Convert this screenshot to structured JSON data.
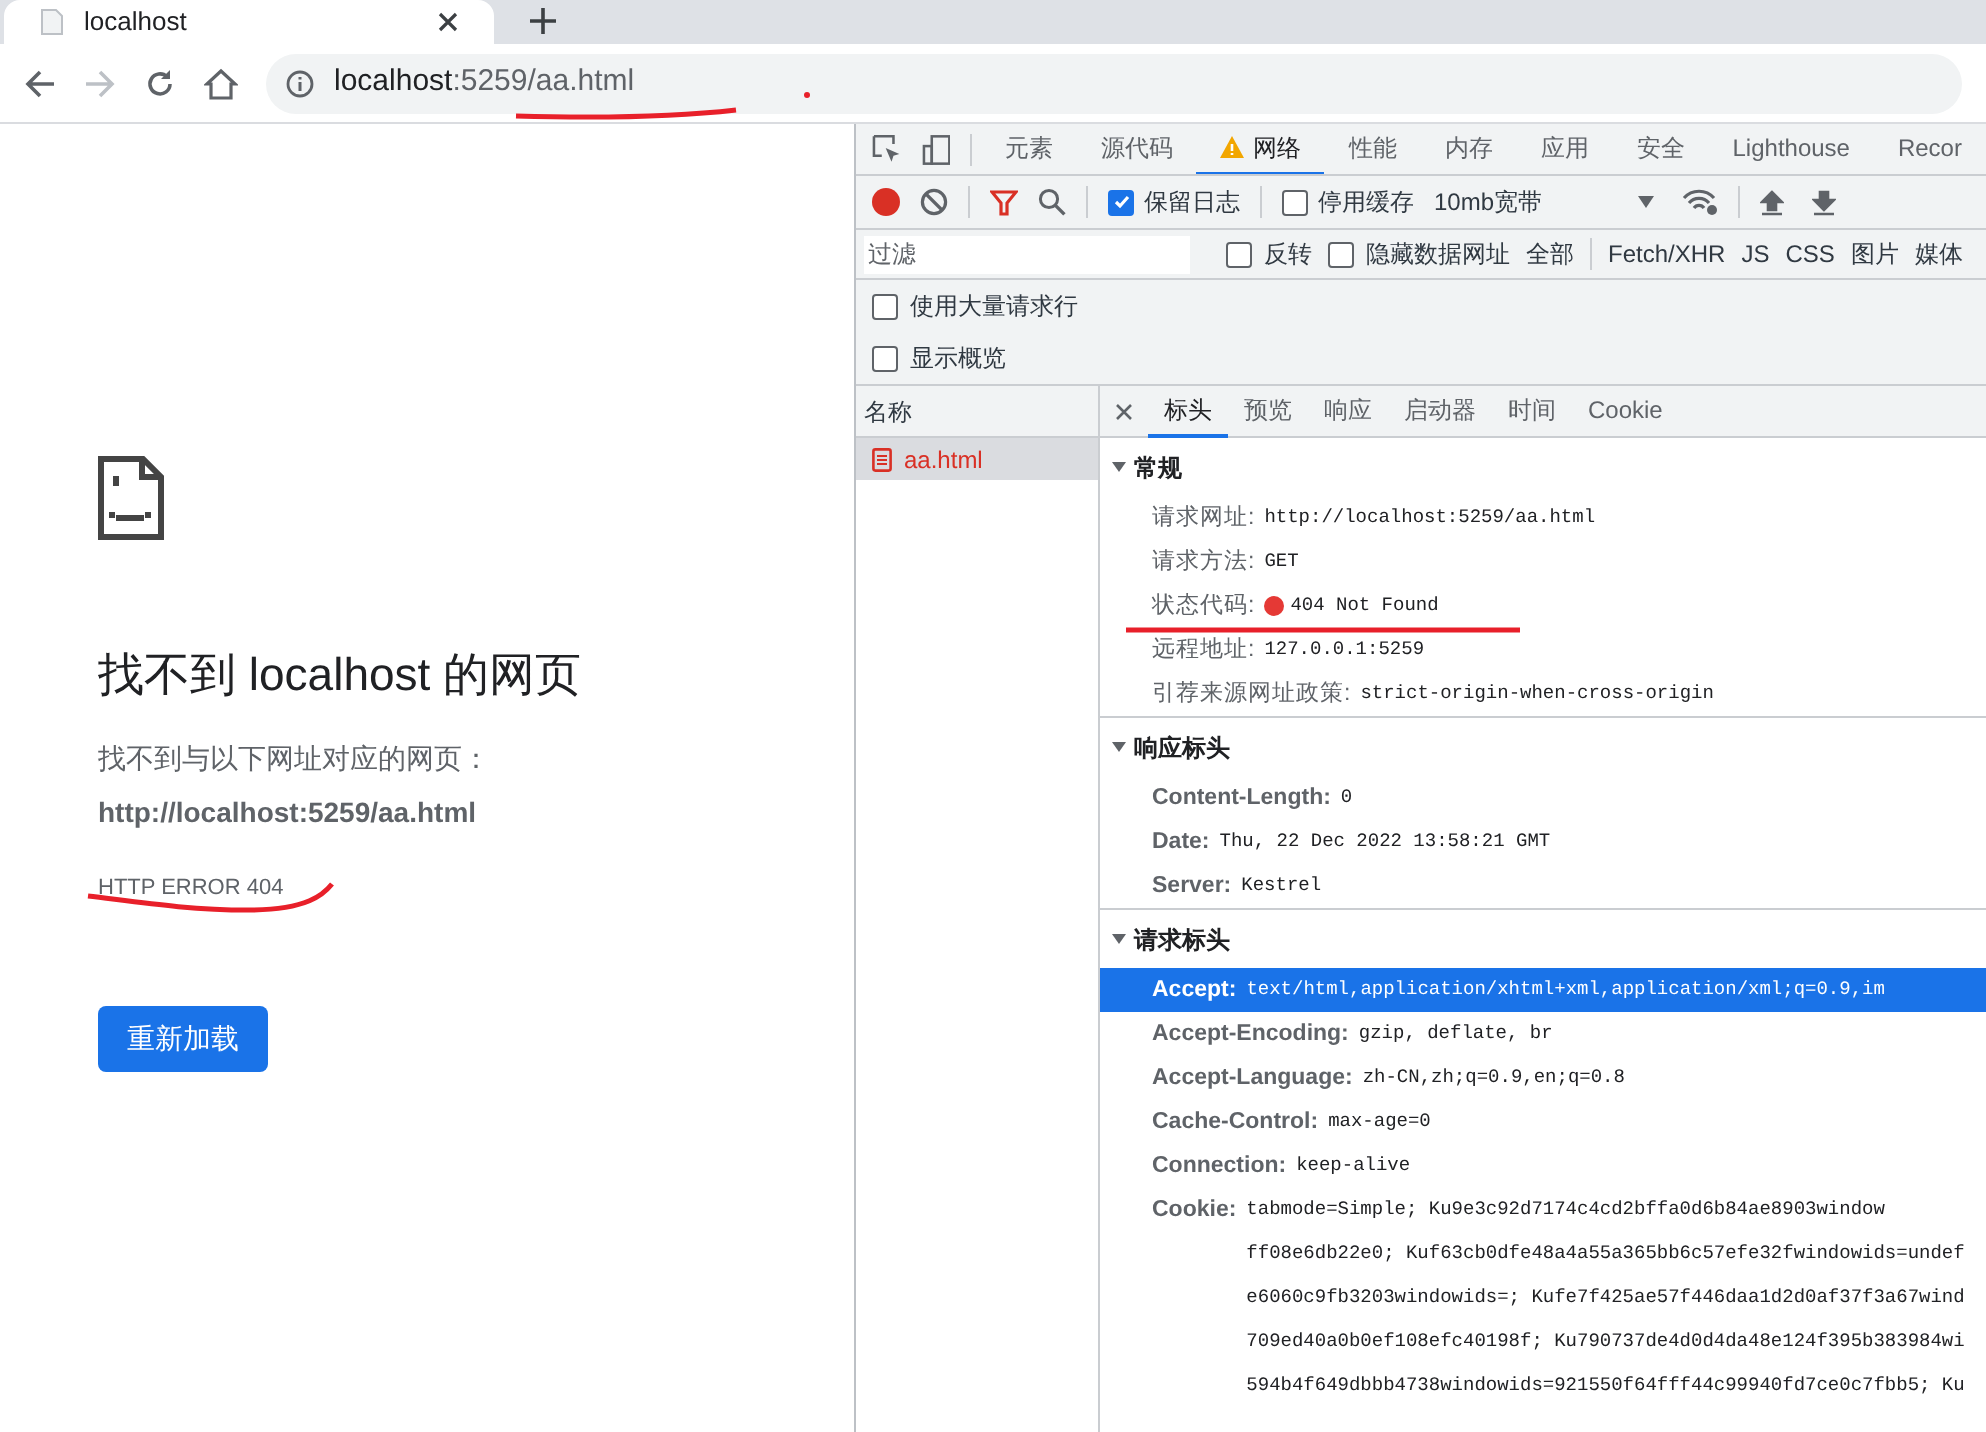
{
  "browser": {
    "tab": {
      "title": "localhost"
    },
    "address": {
      "host": "localhost",
      "path": ":5259/aa.html"
    }
  },
  "page": {
    "title": "找不到 localhost 的网页",
    "message": "找不到与以下网址对应的网页：",
    "url": "http://localhost:5259/aa.html",
    "error_code": "HTTP ERROR 404",
    "reload_button": "重新加载"
  },
  "devtools": {
    "tabs": [
      {
        "label": "元素",
        "selected": false,
        "warning": false
      },
      {
        "label": "源代码",
        "selected": false,
        "warning": false
      },
      {
        "label": "网络",
        "selected": true,
        "warning": true
      },
      {
        "label": "性能",
        "selected": false,
        "warning": false
      },
      {
        "label": "内存",
        "selected": false,
        "warning": false
      },
      {
        "label": "应用",
        "selected": false,
        "warning": false
      },
      {
        "label": "安全",
        "selected": false,
        "warning": false
      },
      {
        "label": "Lighthouse",
        "selected": false,
        "warning": false
      },
      {
        "label": "Recor",
        "selected": false,
        "warning": false
      }
    ],
    "toolbar": {
      "recording": true,
      "filter_active": true,
      "preserve_log": {
        "label": "保留日志",
        "checked": true
      },
      "disable_cache": {
        "label": "停用缓存",
        "checked": false
      },
      "throttling": "10mb宽带"
    },
    "filter_bar": {
      "placeholder": "过滤",
      "invert": {
        "label": "反转",
        "checked": false
      },
      "hide_data_urls": {
        "label": "隐藏数据网址",
        "checked": false
      },
      "types": [
        {
          "label": "全部",
          "selected": false
        },
        {
          "label": "Fetch/XHR",
          "selected": false
        },
        {
          "label": "JS",
          "selected": false
        },
        {
          "label": "CSS",
          "selected": false
        },
        {
          "label": "图片",
          "selected": false
        },
        {
          "label": "媒体",
          "selected": false
        }
      ]
    },
    "options": [
      {
        "label": "使用大量请求行",
        "checked": false
      },
      {
        "label": "显示概览",
        "checked": false
      }
    ],
    "requests": {
      "column": "名称",
      "rows": [
        {
          "name": "aa.html",
          "selected": true
        }
      ]
    },
    "detail_tabs": [
      {
        "label": "标头",
        "selected": true
      },
      {
        "label": "预览",
        "selected": false
      },
      {
        "label": "响应",
        "selected": false
      },
      {
        "label": "启动器",
        "selected": false
      },
      {
        "label": "时间",
        "selected": false
      },
      {
        "label": "Cookie",
        "selected": false
      }
    ],
    "sections": [
      {
        "title": "常规",
        "expanded": true,
        "rows": [
          {
            "key": "请求网址:",
            "value": [
              "http://localhost:5259/aa.html"
            ],
            "selected": false
          },
          {
            "key": "请求方法:",
            "value": [
              "GET"
            ],
            "selected": false
          },
          {
            "key": "状态代码:",
            "value": [
              "404 Not Found"
            ],
            "color": "#e53935",
            "selected": false
          },
          {
            "key": "远程地址:",
            "value": [
              "127.0.0.1:5259"
            ],
            "selected": false
          },
          {
            "key": "引荐来源网址政策:",
            "value": [
              "strict-origin-when-cross-origin"
            ],
            "selected": false
          }
        ]
      },
      {
        "title": "响应标头",
        "expanded": true,
        "rows": [
          {
            "key": "Content-Length:",
            "value": [
              "0"
            ],
            "selected": false
          },
          {
            "key": "Date:",
            "value": [
              "Thu, 22 Dec 2022 13:58:21 GMT"
            ],
            "selected": false
          },
          {
            "key": "Server:",
            "value": [
              "Kestrel"
            ],
            "selected": false
          }
        ]
      },
      {
        "title": "请求标头",
        "expanded": true,
        "rows": [
          {
            "key": "Accept:",
            "value": [
              "text/html,application/xhtml+xml,application/xml;q=0.9,im"
            ],
            "selected": true
          },
          {
            "key": "Accept-Encoding:",
            "value": [
              "gzip, deflate, br"
            ],
            "selected": false
          },
          {
            "key": "Accept-Language:",
            "value": [
              "zh-CN,zh;q=0.9,en;q=0.8"
            ],
            "selected": false
          },
          {
            "key": "Cache-Control:",
            "value": [
              "max-age=0"
            ],
            "selected": false
          },
          {
            "key": "Connection:",
            "value": [
              "keep-alive"
            ],
            "selected": false
          },
          {
            "key": "Cookie:",
            "value": [
              "tabmode=Simple; Ku9e3c92d7174c4cd2bffa0d6b84ae8903window",
              "ff08e6db22e0; Kuf63cb0dfe48a4a55a365bb6c57efe32fwindowids=undef",
              "e6060c9fb3203windowids=; Kufe7f425ae57f446daa1d2d0af37f3a67wind",
              "709ed40a0b0ef108efc40198f; Ku790737de4d0d4da48e124f395b383984wi",
              "594b4f649dbbb4738windowids=921550f64fff44c99940fd7ce0c7fbb5; Ku"
            ],
            "selected": false
          }
        ]
      }
    ]
  }
}
